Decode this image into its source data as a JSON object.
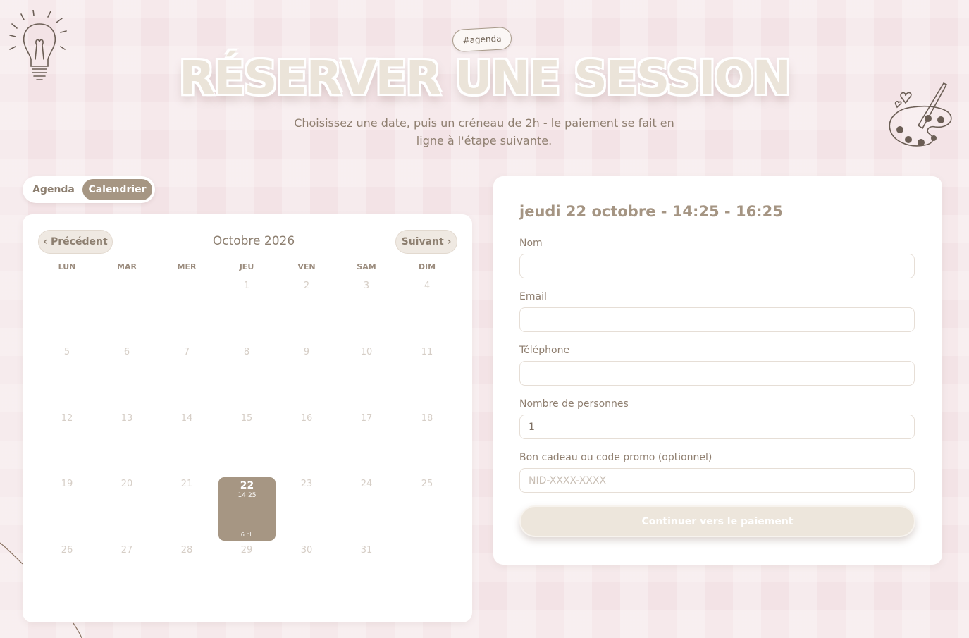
{
  "header": {
    "tag": "#agenda",
    "title": "RÉSERVER UNE SESSION",
    "subtitle": "Choisissez une date, puis un créneau de 2h - le paiement se fait en ligne à l'étape suivante."
  },
  "view_toggle": {
    "agenda_label": "Agenda",
    "calendar_label": "Calendrier",
    "active": "Calendrier"
  },
  "calendar": {
    "prev_label": "‹ Précédent",
    "next_label": "Suivant ›",
    "month_label": "Octobre 2026",
    "weekdays": [
      "LUN",
      "MAR",
      "MER",
      "JEU",
      "VEN",
      "SAM",
      "DIM"
    ],
    "days": [
      [
        "",
        "",
        "",
        "1",
        "2",
        "3",
        "4"
      ],
      [
        "5",
        "6",
        "7",
        "8",
        "9",
        "10",
        "11"
      ],
      [
        "12",
        "13",
        "14",
        "15",
        "16",
        "17",
        "18"
      ],
      [
        "19",
        "20",
        "21",
        "22",
        "23",
        "24",
        "25"
      ],
      [
        "26",
        "27",
        "28",
        "29",
        "30",
        "31",
        ""
      ]
    ],
    "selected_day": {
      "day": "22",
      "time": "14:25",
      "places": "6 pl."
    }
  },
  "form": {
    "title": "jeudi 22 octobre - 14:25 - 16:25",
    "name_label": "Nom",
    "name_value": "",
    "email_label": "Email",
    "email_value": "",
    "phone_label": "Téléphone",
    "phone_value": "",
    "people_label": "Nombre de personnes",
    "people_value": "1",
    "promo_label": "Bon cadeau ou code promo (optionnel)",
    "promo_placeholder": "NID-XXXX-XXXX",
    "submit_label": "Continuer vers le paiement"
  },
  "colors": {
    "accent": "#a69683",
    "background": "#f3e3e6",
    "pencil": "#e8bfc6"
  }
}
